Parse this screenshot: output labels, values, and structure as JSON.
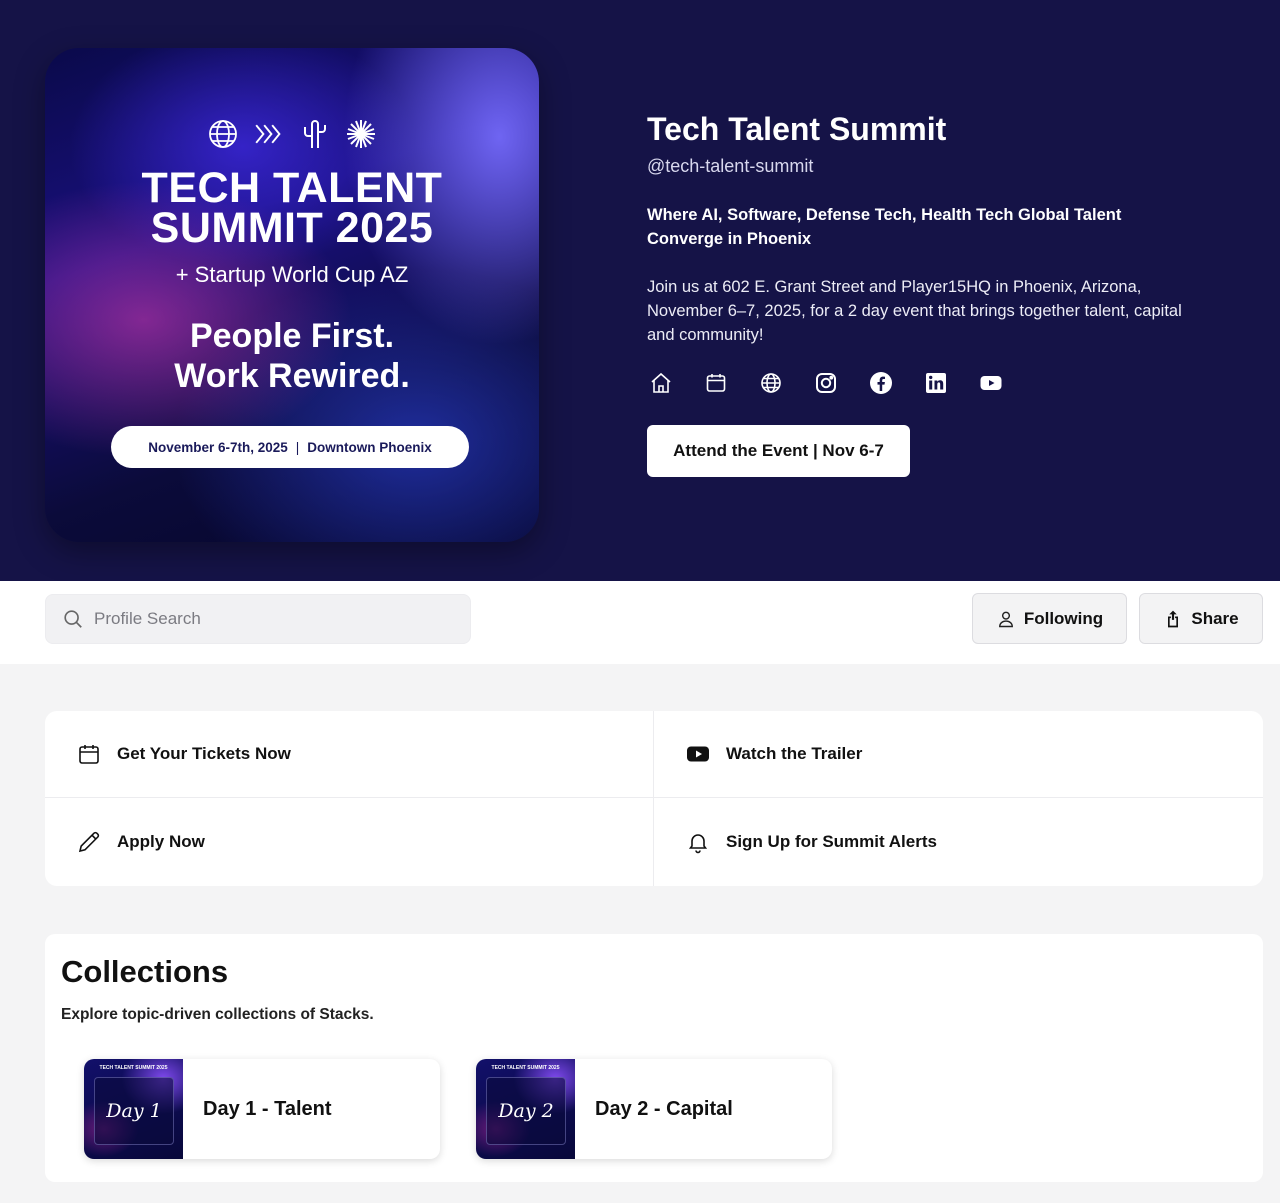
{
  "poster": {
    "title_line1": "TECH TALENT",
    "title_line2": "SUMMIT 2025",
    "subtitle": "+ Startup World Cup AZ",
    "tagline_line1": "People First.",
    "tagline_line2": "Work Rewired.",
    "pill_date": "November 6-7th, 2025",
    "pill_sep": "|",
    "pill_location": "Downtown Phoenix",
    "icons": [
      "globe-icon",
      "chevrons-icon",
      "cactus-icon",
      "burst-icon"
    ]
  },
  "profile": {
    "name": "Tech Talent Summit",
    "handle": "@tech-talent-summit",
    "headline": "Where AI, Software, Defense Tech, Health Tech Global Talent Converge in Phoenix",
    "description": "Join us at 602 E. Grant Street and Player15HQ in Phoenix, Arizona, November 6–7, 2025, for a 2 day event that brings together talent, capital and community!",
    "social_icons": [
      "home-icon",
      "calendar-icon",
      "globe-icon",
      "instagram-icon",
      "facebook-icon",
      "linkedin-icon",
      "youtube-icon"
    ],
    "cta_label": "Attend the Event | Nov 6-7"
  },
  "toolbar": {
    "search_placeholder": "Profile Search",
    "following_label": "Following",
    "share_label": "Share"
  },
  "links": [
    {
      "label": "Get Your Tickets Now",
      "icon": "calendar-icon"
    },
    {
      "label": "Watch the Trailer",
      "icon": "youtube-icon"
    },
    {
      "label": "Apply Now",
      "icon": "pencil-icon"
    },
    {
      "label": "Sign Up for Summit Alerts",
      "icon": "bell-icon"
    }
  ],
  "collections": {
    "title": "Collections",
    "subtitle": "Explore topic-driven collections of Stacks.",
    "items": [
      {
        "name": "Day 1 - Talent",
        "thumb_label": "Day 1",
        "thumb_top": "TECH TALENT SUMMIT 2025"
      },
      {
        "name": "Day 2 - Capital",
        "thumb_label": "Day 2",
        "thumb_top": "TECH TALENT SUMMIT 2025"
      }
    ]
  },
  "colors": {
    "hero_bg": "#151347",
    "page_bg": "#f4f4f5",
    "card_bg": "#ffffff"
  }
}
